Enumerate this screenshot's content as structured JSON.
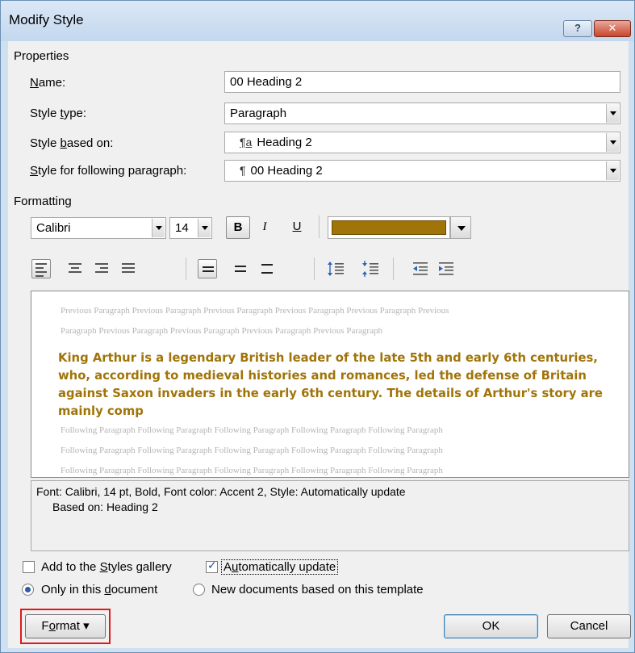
{
  "window": {
    "title": "Modify Style",
    "help_label": "?",
    "close_label": "✕"
  },
  "properties": {
    "section_label": "Properties",
    "name_label_u": "N",
    "name_label_rest": "ame:",
    "name_value": "00 Heading 2",
    "style_type_label_pre": "Style ",
    "style_type_label_u": "t",
    "style_type_label_rest": "ype:",
    "style_type_value": "Paragraph",
    "based_on_label_pre": "Style ",
    "based_on_label_u": "b",
    "based_on_label_rest": "ased on:",
    "based_on_glyph": "¶a",
    "based_on_value": "Heading 2",
    "following_label_u": "S",
    "following_label_rest": "tyle for following paragraph:",
    "following_glyph": "¶",
    "following_value": "00 Heading 2"
  },
  "formatting": {
    "section_label": "Formatting",
    "font": "Calibri",
    "size": "14",
    "bold_label": "B",
    "italic_label": "I",
    "underline_label": "U",
    "font_color": "#a07408"
  },
  "toolbar_icons": [
    "align-left-icon",
    "align-center-icon",
    "align-right-icon",
    "justify-icon",
    "single-spacing-icon",
    "one-half-spacing-icon",
    "double-spacing-icon",
    "increase-paragraph-spacing-icon",
    "decrease-paragraph-spacing-icon",
    "decrease-indent-icon",
    "increase-indent-icon"
  ],
  "preview": {
    "previous_1": "Previous Paragraph Previous Paragraph Previous Paragraph Previous Paragraph Previous Paragraph Previous",
    "previous_2": "Paragraph Previous Paragraph Previous Paragraph Previous Paragraph Previous Paragraph",
    "sample_text": "King Arthur is a legendary British leader of the late 5th and early 6th centuries, who, according to medieval histories and romances, led the defense of Britain against Saxon invaders in the early 6th century. The details of Arthur's story are mainly comp",
    "following_1": "Following Paragraph Following Paragraph Following Paragraph Following Paragraph Following Paragraph",
    "following_2": "Following Paragraph Following Paragraph Following Paragraph Following Paragraph Following Paragraph",
    "following_3": "Following Paragraph Following Paragraph Following Paragraph Following Paragraph Following Paragraph"
  },
  "description": {
    "line1": "Font: Calibri, 14 pt, Bold, Font color: Accent 2, Style: Automatically update",
    "line2": "Based on: Heading 2"
  },
  "options": {
    "add_gallery_pre": "Add to the ",
    "add_gallery_u": "S",
    "add_gallery_rest": "tyles gallery",
    "add_gallery_checked": false,
    "auto_update_pre": "A",
    "auto_update_u": "u",
    "auto_update_rest": "tomatically update",
    "auto_update_checked": true,
    "only_doc_pre": "Only in this ",
    "only_doc_u": "d",
    "only_doc_rest": "ocument",
    "only_doc_selected": true,
    "new_docs_label": "New documents based on this template",
    "new_docs_selected": false
  },
  "buttons": {
    "format_pre": "F",
    "format_u": "o",
    "format_rest": "rmat",
    "format_arrow": "▾",
    "ok": "OK",
    "cancel": "Cancel"
  }
}
